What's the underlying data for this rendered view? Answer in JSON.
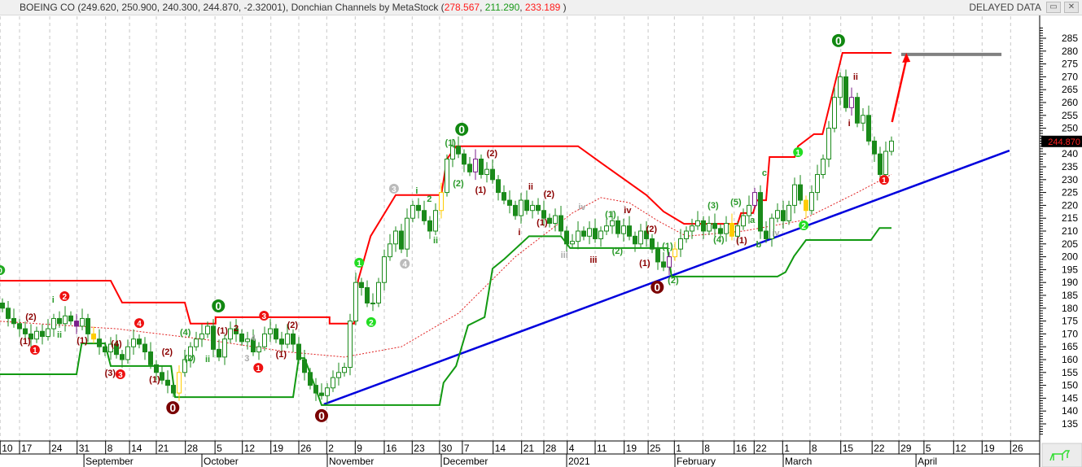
{
  "header": {
    "symbol": "BOEING CO",
    "ohlc_text": "(249.620, 250.900, 240.300, 244.870, -2.32001)",
    "indicator": ", Donchian Channels by MetaStock",
    "ind_open": " (",
    "ind_upper": "278.567",
    "ind_lower": "211.290",
    "ind_mid": "233.189",
    "ind_close": " )",
    "sep": ", ",
    "status": "DELAYED DATA",
    "restore_icon": "restore-icon",
    "close_icon": "close-icon"
  },
  "chart_data": {
    "type": "candlestick",
    "title": "BOEING CO",
    "ylim": [
      130,
      290
    ],
    "yticks": [
      135,
      140,
      145,
      150,
      155,
      160,
      165,
      170,
      175,
      180,
      185,
      190,
      195,
      200,
      205,
      210,
      215,
      220,
      225,
      230,
      235,
      240,
      245,
      250,
      255,
      260,
      265,
      270,
      275,
      280,
      285
    ],
    "last_price_label": "244.870",
    "closes": [
      180,
      176,
      174,
      172,
      170,
      168,
      171,
      169,
      172,
      176,
      174,
      177,
      175,
      173,
      176,
      170,
      168,
      165,
      163,
      166,
      162,
      160,
      165,
      168,
      166,
      163,
      158,
      155,
      152,
      150,
      147,
      155,
      160,
      165,
      168,
      170,
      173,
      164,
      161,
      168,
      172,
      170,
      167,
      168,
      163,
      165,
      170,
      172,
      168,
      166,
      170,
      166,
      160,
      155,
      150,
      147,
      146,
      149,
      153,
      155,
      157,
      175,
      190,
      188,
      182,
      182,
      190,
      200,
      205,
      210,
      203,
      215,
      220,
      218,
      214,
      210,
      218,
      225,
      238,
      243,
      240,
      236,
      233,
      238,
      232,
      234,
      230,
      225,
      222,
      220,
      216,
      222,
      218,
      220,
      218,
      215,
      213,
      216,
      210,
      205,
      206,
      210,
      208,
      211,
      207,
      210,
      212,
      214,
      209,
      212,
      208,
      205,
      210,
      207,
      203,
      198,
      196,
      200,
      203,
      207,
      210,
      212,
      214,
      210,
      213,
      211,
      209,
      213,
      208,
      212,
      216,
      220,
      225,
      210,
      207,
      215,
      218,
      214,
      220,
      228,
      222,
      218,
      225,
      232,
      238,
      250,
      262,
      270,
      258,
      262,
      252,
      255,
      245,
      240,
      232,
      241,
      245
    ],
    "purple_bars": [
      13,
      83,
      117,
      132,
      149
    ],
    "yellow_bars": [
      16,
      31,
      77,
      118,
      128,
      141
    ],
    "x_ticks": [
      {
        "label": "10",
        "i": -0.4
      },
      {
        "label": "17",
        "i": 3
      },
      {
        "label": "24",
        "i": 8.3
      },
      {
        "label": "31",
        "i": 13.1
      },
      {
        "label": "8",
        "i": 18.1
      },
      {
        "label": "14",
        "i": 22.3
      },
      {
        "label": "21",
        "i": 27
      },
      {
        "label": "28",
        "i": 32.1
      },
      {
        "label": "5",
        "i": 37.3
      },
      {
        "label": "12",
        "i": 42.1
      },
      {
        "label": "19",
        "i": 47.1
      },
      {
        "label": "26",
        "i": 52
      },
      {
        "label": "2",
        "i": 56.9
      },
      {
        "label": "9",
        "i": 61.9
      },
      {
        "label": "16",
        "i": 67
      },
      {
        "label": "23",
        "i": 71.9
      },
      {
        "label": "30",
        "i": 76.7
      },
      {
        "label": "7",
        "i": 80.7
      },
      {
        "label": "14",
        "i": 86.1
      },
      {
        "label": "21",
        "i": 91.1
      },
      {
        "label": "28",
        "i": 95
      },
      {
        "label": "4",
        "i": 99.1
      },
      {
        "label": "11",
        "i": 104
      },
      {
        "label": "19",
        "i": 109.1
      },
      {
        "label": "25",
        "i": 113.3
      },
      {
        "label": "1",
        "i": 117.9
      },
      {
        "label": "8",
        "i": 122.9
      },
      {
        "label": "16",
        "i": 128.4
      },
      {
        "label": "22",
        "i": 131.9
      },
      {
        "label": "1",
        "i": 136.9
      },
      {
        "label": "8",
        "i": 141.7
      },
      {
        "label": "15",
        "i": 147.1
      },
      {
        "label": "22",
        "i": 152.6
      },
      {
        "label": "29",
        "i": 157.3
      },
      {
        "label": "5",
        "i": 161.7
      },
      {
        "label": "12",
        "i": 166.9
      },
      {
        "label": "19",
        "i": 171.9
      },
      {
        "label": "26",
        "i": 176.9
      }
    ],
    "month_labels": [
      {
        "label": "September",
        "i": 14.3
      },
      {
        "label": "October",
        "i": 35
      },
      {
        "label": "November",
        "i": 57
      },
      {
        "label": "December",
        "i": 77
      },
      {
        "label": "2021",
        "i": 99
      },
      {
        "label": "February",
        "i": 118
      },
      {
        "label": "March",
        "i": 137
      },
      {
        "label": "April",
        "i": 160.3
      }
    ],
    "donchian_upper": [
      [
        -1,
        190.7
      ],
      [
        19,
        190.7
      ],
      [
        21,
        182.2
      ],
      [
        32,
        182.2
      ],
      [
        33,
        174
      ],
      [
        37.4,
        174
      ],
      [
        37.4,
        176.5
      ],
      [
        57.4,
        176.5
      ],
      [
        57.4,
        174
      ],
      [
        61.7,
        174
      ],
      [
        62.4,
        190.7
      ],
      [
        64.6,
        208
      ],
      [
        69,
        224
      ],
      [
        77,
        224
      ],
      [
        78,
        238
      ],
      [
        79.6,
        243
      ],
      [
        101,
        243
      ],
      [
        105,
        236.6
      ],
      [
        113,
        224
      ],
      [
        116,
        217.6
      ],
      [
        119.6,
        212.8
      ],
      [
        129,
        212.8
      ],
      [
        129.6,
        217
      ],
      [
        131.7,
        217
      ],
      [
        132.4,
        222
      ],
      [
        134,
        222
      ],
      [
        134.6,
        238.8
      ],
      [
        139,
        238.8
      ],
      [
        139.6,
        243
      ],
      [
        142.4,
        247.7
      ],
      [
        143.9,
        247.7
      ],
      [
        147.4,
        279.3
      ],
      [
        156,
        279.3
      ]
    ],
    "donchian_lower": [
      [
        -1,
        154.3
      ],
      [
        13,
        154.3
      ],
      [
        13.9,
        166.3
      ],
      [
        18,
        166.3
      ],
      [
        19,
        157.5
      ],
      [
        29.6,
        157.5
      ],
      [
        30.3,
        145.4
      ],
      [
        51,
        145.4
      ],
      [
        52,
        160.6
      ],
      [
        53,
        160.6
      ],
      [
        54.6,
        151
      ],
      [
        56,
        142.3
      ],
      [
        76.7,
        142.3
      ],
      [
        77.4,
        151
      ],
      [
        79.6,
        157.5
      ],
      [
        81.7,
        173.3
      ],
      [
        84.6,
        176.5
      ],
      [
        86,
        195.4
      ],
      [
        88.1,
        199.2
      ],
      [
        92.4,
        208
      ],
      [
        98,
        208
      ],
      [
        99.6,
        203.4
      ],
      [
        116.7,
        203.4
      ],
      [
        117.4,
        192.3
      ],
      [
        136,
        192.3
      ],
      [
        137.4,
        194
      ],
      [
        138.9,
        200.2
      ],
      [
        141,
        206.5
      ],
      [
        152.4,
        206.5
      ],
      [
        153.9,
        211.2
      ],
      [
        156,
        211.2
      ]
    ],
    "donchian_mid": [
      [
        -1,
        175
      ],
      [
        20,
        172
      ],
      [
        35,
        168
      ],
      [
        50,
        163
      ],
      [
        60,
        161
      ],
      [
        70,
        165
      ],
      [
        80,
        178
      ],
      [
        90,
        200
      ],
      [
        100,
        217
      ],
      [
        105,
        223
      ],
      [
        110,
        221
      ],
      [
        115,
        214
      ],
      [
        120,
        208
      ],
      [
        130,
        210
      ],
      [
        140,
        214
      ],
      [
        150,
        225
      ],
      [
        156,
        232
      ]
    ],
    "trendline": [
      [
        56.4,
        142.6
      ],
      [
        176.7,
        241.3
      ]
    ],
    "target_line": [
      [
        157.7,
        278.7
      ],
      [
        175.3,
        278.7
      ]
    ],
    "target_arrow": [
      [
        156.1,
        252.4
      ],
      [
        158.6,
        279.3
      ]
    ],
    "wave_labels": [
      {
        "t": "0",
        "i": -0.4,
        "p": 194.8,
        "s": "cg"
      },
      {
        "t": "(2)",
        "i": 5,
        "p": 176.8,
        "s": "m"
      },
      {
        "t": "(1)",
        "i": 4,
        "p": 167.3,
        "s": "m"
      },
      {
        "t": "1",
        "i": 5.7,
        "p": 163.8,
        "s": "cr"
      },
      {
        "t": "i",
        "i": 8.9,
        "p": 183.4,
        "s": "g"
      },
      {
        "t": "ii",
        "i": 10,
        "p": 169.8,
        "s": "g"
      },
      {
        "t": "2",
        "i": 10.9,
        "p": 184.7,
        "s": "cr"
      },
      {
        "t": "(1)",
        "i": 14,
        "p": 167.6,
        "s": "m"
      },
      {
        "t": "(4)",
        "i": 20,
        "p": 166.3,
        "s": "m"
      },
      {
        "t": "(3)",
        "i": 18.9,
        "p": 154.9,
        "s": "m"
      },
      {
        "t": "3",
        "i": 20.7,
        "p": 154.3,
        "s": "cr"
      },
      {
        "t": "4",
        "i": 24,
        "p": 174.2,
        "s": "cr"
      },
      {
        "t": "(1)",
        "i": 26.7,
        "p": 152.4,
        "s": "m"
      },
      {
        "t": "(2)",
        "i": 28.9,
        "p": 163.2,
        "s": "m"
      },
      {
        "t": "0",
        "i": 29.9,
        "p": 141.3,
        "s": "bm"
      },
      {
        "t": "(4)",
        "i": 32.1,
        "p": 170.8,
        "s": "g"
      },
      {
        "t": "(2)",
        "i": 32.9,
        "p": 160.6,
        "s": "g"
      },
      {
        "t": "ii",
        "i": 36,
        "p": 160.3,
        "s": "g"
      },
      {
        "t": "0",
        "i": 37.9,
        "p": 180.9,
        "s": "bg"
      },
      {
        "t": "2",
        "i": 41,
        "p": 172.3,
        "s": "m"
      },
      {
        "t": "4",
        "i": 44,
        "p": 168.5,
        "s": "gr"
      },
      {
        "t": "3",
        "i": 42.9,
        "p": 160.6,
        "s": "gr"
      },
      {
        "t": "(1)",
        "i": 38.6,
        "p": 171.4,
        "s": "m"
      },
      {
        "t": "3",
        "i": 45.9,
        "p": 177.1,
        "s": "cr"
      },
      {
        "t": "(2)",
        "i": 50.9,
        "p": 173.6,
        "s": "m"
      },
      {
        "t": "(1)",
        "i": 48.9,
        "p": 162.2,
        "s": "m"
      },
      {
        "t": "1",
        "i": 44.9,
        "p": 156.8,
        "s": "cr"
      },
      {
        "t": "0",
        "i": 56,
        "p": 138.2,
        "s": "bm"
      },
      {
        "t": "1",
        "i": 62.6,
        "p": 197.7,
        "s": "cl"
      },
      {
        "t": "2",
        "i": 64.7,
        "p": 174.6,
        "s": "cl"
      },
      {
        "t": "3",
        "i": 68.7,
        "p": 226.5,
        "s": "cx"
      },
      {
        "t": "4",
        "i": 70.6,
        "p": 197.3,
        "s": "cx"
      },
      {
        "t": "i",
        "i": 72.7,
        "p": 225.8,
        "s": "g"
      },
      {
        "t": "2",
        "i": 74.9,
        "p": 222.7,
        "s": "g"
      },
      {
        "t": "ii",
        "i": 76,
        "p": 206.5,
        "s": "g"
      },
      {
        "t": "0",
        "i": 80.6,
        "p": 249.6,
        "s": "bg"
      },
      {
        "t": "(1)",
        "i": 78.6,
        "p": 244.5,
        "s": "g"
      },
      {
        "t": "(2)",
        "i": 80,
        "p": 228.7,
        "s": "g"
      },
      {
        "t": "(2)",
        "i": 85.9,
        "p": 240.4,
        "s": "m"
      },
      {
        "t": "(1)",
        "i": 83.9,
        "p": 226.1,
        "s": "m"
      },
      {
        "t": "ii",
        "i": 92.7,
        "p": 227.4,
        "s": "m"
      },
      {
        "t": "(2)",
        "i": 95.9,
        "p": 224.6,
        "s": "m"
      },
      {
        "t": "(1)",
        "i": 94.7,
        "p": 213.5,
        "s": "m"
      },
      {
        "t": "i",
        "i": 90.7,
        "p": 209.7,
        "s": "m"
      },
      {
        "t": "iii",
        "i": 98.6,
        "p": 200.8,
        "s": "gr"
      },
      {
        "t": "iv",
        "i": 101.7,
        "p": 219.5,
        "s": "gr"
      },
      {
        "t": "iii",
        "i": 103.7,
        "p": 198.9,
        "s": "m"
      },
      {
        "t": "(1)",
        "i": 106.7,
        "p": 216.6,
        "s": "g"
      },
      {
        "t": "iv",
        "i": 109.7,
        "p": 218.2,
        "s": "m"
      },
      {
        "t": "(2)",
        "i": 107.9,
        "p": 202.4,
        "s": "g"
      },
      {
        "t": "(2)",
        "i": 113.9,
        "p": 210.9,
        "s": "m"
      },
      {
        "t": "(1)",
        "i": 112.7,
        "p": 197.7,
        "s": "m"
      },
      {
        "t": "(1)",
        "i": 116.7,
        "p": 204.3,
        "s": "g"
      },
      {
        "t": "(2)",
        "i": 117.7,
        "p": 191,
        "s": "g"
      },
      {
        "t": "0",
        "i": 114.9,
        "p": 188.2,
        "s": "bm"
      },
      {
        "t": "(3)",
        "i": 124.7,
        "p": 220.1,
        "s": "g"
      },
      {
        "t": "(5)",
        "i": 128.7,
        "p": 221.4,
        "s": "g"
      },
      {
        "t": "(4)",
        "i": 125.7,
        "p": 206.8,
        "s": "g"
      },
      {
        "t": "(1)",
        "i": 129.7,
        "p": 206.5,
        "s": "m"
      },
      {
        "t": "a",
        "i": 131.6,
        "p": 214.4,
        "s": "g"
      },
      {
        "t": "c",
        "i": 133.7,
        "p": 232.8,
        "s": "g"
      },
      {
        "t": "b",
        "i": 132.7,
        "p": 204.9,
        "s": "g"
      },
      {
        "t": "iv",
        "i": 135.7,
        "p": 209.4,
        "s": "gr"
      },
      {
        "t": "1",
        "i": 139.6,
        "p": 240.7,
        "s": "cl"
      },
      {
        "t": "2",
        "i": 140.6,
        "p": 212.2,
        "s": "cl"
      },
      {
        "t": "0",
        "i": 146.7,
        "p": 284.1,
        "s": "bg"
      },
      {
        "t": "ii",
        "i": 149.7,
        "p": 270.1,
        "s": "m"
      },
      {
        "t": "i",
        "i": 148.6,
        "p": 252.1,
        "s": "m"
      },
      {
        "t": "1",
        "i": 154.7,
        "p": 229.9,
        "s": "cr"
      }
    ],
    "colors": {
      "up": "#1a8a1a",
      "down": "#1a8a1a",
      "purple": "#7a1f8a",
      "yellow": "#ffcc00",
      "upper": "#ff0000",
      "lower": "#119911",
      "mid": "#e02020",
      "trend": "#0000dd",
      "target": "#808080"
    }
  }
}
